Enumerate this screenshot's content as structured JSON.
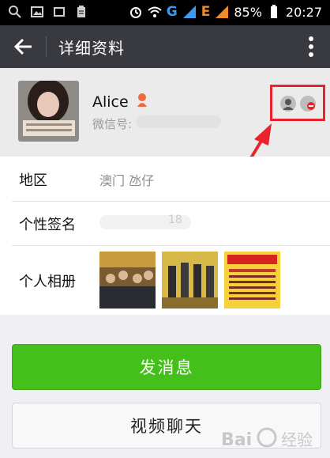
{
  "statusbar": {
    "battery_percent": "85%",
    "time": "20:27",
    "network_g": "G",
    "network_e": "E",
    "icons": [
      "search-icon",
      "image-icon",
      "photo-icon",
      "clipboard-icon",
      "alarm-icon",
      "wifi-icon",
      "signal-icon",
      "signal-icon",
      "battery-icon"
    ]
  },
  "appbar": {
    "title": "详细资料",
    "back_icon": "back-arrow-icon",
    "more_icon": "more-vertical-icon"
  },
  "profile": {
    "name": "Alice",
    "gender_icon": "female-icon",
    "wechat_id_label": "微信号: ",
    "action_icons": [
      "contact-icon",
      "remove-contact-icon"
    ]
  },
  "info": {
    "region_label": "地区",
    "region_value": "澳门  氹仔",
    "signature_label": "个性签名",
    "signature_tail": "18",
    "album_label": "个人相册"
  },
  "buttons": {
    "send_message": "发消息",
    "video_call": "视频聊天"
  },
  "watermark": {
    "text": "Bai 经验"
  },
  "colors": {
    "appbar": "#393a3f",
    "green_button": "#45c01a",
    "highlight_red": "#e8232b"
  }
}
